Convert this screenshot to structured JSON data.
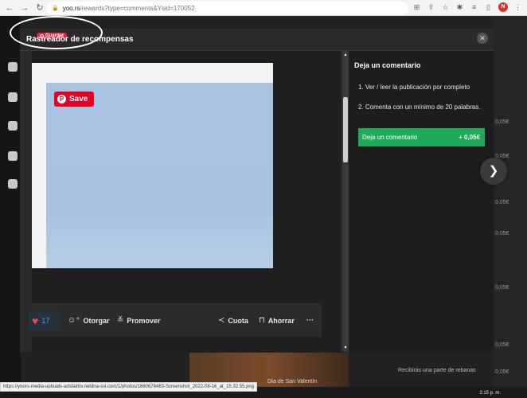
{
  "browser": {
    "url_host": "yoo.rs",
    "url_path": "/rewards?type=comments&Ysid=170052",
    "profile_initial": "N"
  },
  "background": {
    "prices": [
      "0,05€",
      "0,05€",
      "0,05€",
      "0,05€",
      "0,05€",
      "0,05€",
      "0,05€"
    ],
    "bottom_caption": "Día de San Valentín",
    "bottom_right_text": "Recibirás una parte de rebanas"
  },
  "modal": {
    "brand_badge": "Guardar",
    "title": "Rastreador de recompensas",
    "close_symbol": "✕"
  },
  "post": {
    "pin_save_label": "Save",
    "like_count": "17",
    "actions": {
      "award": "Otorgar",
      "promote": "Promover",
      "share": "Cuota",
      "save": "Ahorrar",
      "more": "···"
    }
  },
  "panel": {
    "title": "Deja un comentario",
    "steps": [
      "1. Ver / leer la publicación por completo",
      "2. Comenta con un mínimo de 20 palabras."
    ],
    "button_label": "Deja un comentario",
    "button_amount": "+ 0,05€"
  },
  "status": {
    "link_url": "https://yoors-media-uploads-adsfairbv.netdna-ssl.com/1/photos/1660678483-Screenshot_2022-08-16_at_15.32.55.png",
    "time": "2:15 p. m."
  },
  "colors": {
    "accent_green": "#1eaa5b",
    "pinterest_red": "#e60023",
    "heart_red": "#e84b4b"
  }
}
